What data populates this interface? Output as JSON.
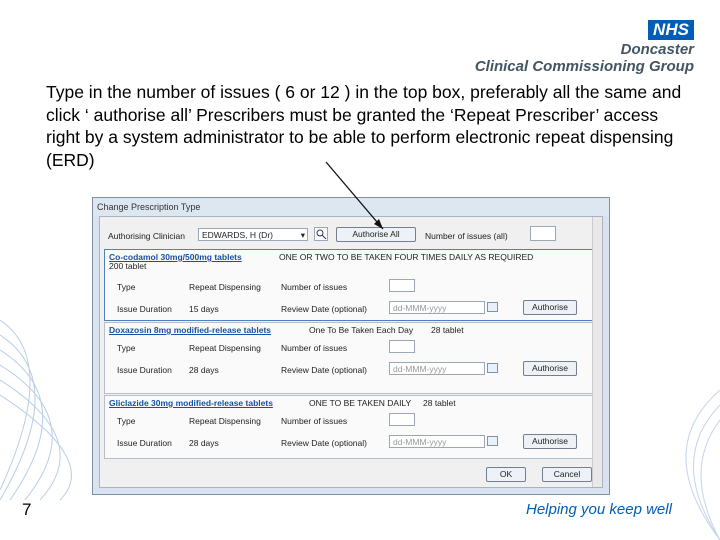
{
  "branding": {
    "nhs_logo": "NHS",
    "org_line1": "Doncaster",
    "org_line2": "Clinical Commissioning Group",
    "tagline": "Helping you keep well",
    "nhs_blue": "#005eb8"
  },
  "slide": {
    "instruction": "Type in the number of issues ( 6 or 12 ) in the top box, preferably all the same and click ‘ authorise all’ Prescribers must be granted the ‘Repeat Prescriber’ access right by a system administrator to be able to perform electronic repeat dispensing (ERD)",
    "page_number": "7"
  },
  "dialog": {
    "title": "Change Prescription Type",
    "authorising_label": "Authorising Clinician",
    "clinician_value": "EDWARDS, H (Dr)",
    "authorise_all_label": "Authorise All",
    "num_issues_all_label": "Number of issues (all)",
    "ok_label": "OK",
    "cancel_label": "Cancel",
    "drugs": [
      {
        "name": "Co-codamol 30mg/500mg tablets",
        "dosage": "ONE OR TWO TO BE TAKEN FOUR TIMES DAILY AS REQUIRED",
        "quantity": "200 tablet",
        "type_label": "Type",
        "type_value": "Repeat Dispensing",
        "issues_label": "Number of issues",
        "duration_label": "Issue Duration",
        "duration_value": "15 days",
        "review_label": "Review Date (optional)",
        "review_placeholder": "dd-MMM-yyyy",
        "authorise_label": "Authorise"
      },
      {
        "name": "Doxazosin 8mg modified-release tablets",
        "dosage": "One To Be Taken Each Day",
        "quantity": "28 tablet",
        "type_label": "Type",
        "type_value": "Repeat Dispensing",
        "issues_label": "Number of issues",
        "duration_label": "Issue Duration",
        "duration_value": "28 days",
        "review_label": "Review Date (optional)",
        "review_placeholder": "dd-MMM-yyyy",
        "authorise_label": "Authorise"
      },
      {
        "name": "Gliclazide 30mg modified-release tablets",
        "dosage": "ONE TO BE TAKEN DAILY",
        "quantity": "28 tablet",
        "type_label": "Type",
        "type_value": "Repeat Dispensing",
        "issues_label": "Number of issues",
        "duration_label": "Issue Duration",
        "duration_value": "28 days",
        "review_label": "Review Date (optional)",
        "review_placeholder": "dd-MMM-yyyy",
        "authorise_label": "Authorise"
      }
    ]
  }
}
